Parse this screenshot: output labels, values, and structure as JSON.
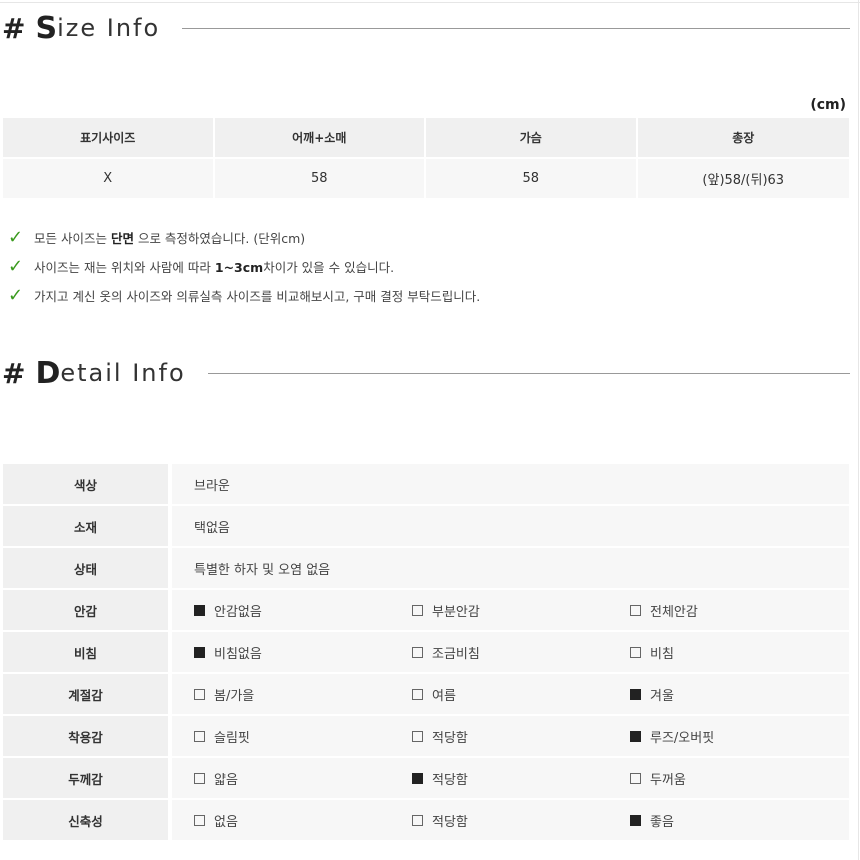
{
  "size_info": {
    "heading_hash": "#",
    "heading_initial": "S",
    "heading_rest": "ize Info",
    "unit": "(cm)",
    "headers": [
      "표기사이즈",
      "어깨+소매",
      "가슴",
      "총장"
    ],
    "rows": [
      [
        "X",
        "58",
        "58",
        "(앞)58/(뒤)63"
      ]
    ],
    "notes": [
      {
        "before": "모든 사이즈는 ",
        "bold": "단면",
        "after": " 으로 측정하였습니다. (단위cm)"
      },
      {
        "before": "사이즈는 재는 위치와 사람에 따라 ",
        "bold": "1~3cm",
        "after": "차이가 있을 수 있습니다."
      },
      {
        "before": "가지고 계신 옷의 사이즈와 의류실측 사이즈를 비교해보시고, 구매 결정 부탁드립니다.",
        "bold": "",
        "after": ""
      }
    ],
    "check_icon": "check-mark-icon",
    "check_color": "#3a9a1e"
  },
  "detail_info": {
    "heading_hash": "#",
    "heading_initial": "D",
    "heading_rest": "etail Info",
    "text_rows": [
      {
        "label": "색상",
        "value": "브라운"
      },
      {
        "label": "소재",
        "value": "택없음"
      },
      {
        "label": "상태",
        "value": "특별한 하자 및 오염 없음"
      }
    ],
    "option_rows": [
      {
        "label": "안감",
        "options": [
          {
            "text": "안감없음",
            "checked": true
          },
          {
            "text": "부분안감",
            "checked": false
          },
          {
            "text": "전체안감",
            "checked": false
          }
        ]
      },
      {
        "label": "비침",
        "options": [
          {
            "text": "비침없음",
            "checked": true
          },
          {
            "text": "조금비침",
            "checked": false
          },
          {
            "text": "비침",
            "checked": false
          }
        ]
      },
      {
        "label": "계절감",
        "options": [
          {
            "text": "봄/가을",
            "checked": false
          },
          {
            "text": "여름",
            "checked": false
          },
          {
            "text": "겨울",
            "checked": true
          }
        ]
      },
      {
        "label": "착용감",
        "options": [
          {
            "text": "슬림핏",
            "checked": false
          },
          {
            "text": "적당함",
            "checked": false
          },
          {
            "text": "루즈/오버핏",
            "checked": true
          }
        ]
      },
      {
        "label": "두께감",
        "options": [
          {
            "text": "얇음",
            "checked": false
          },
          {
            "text": "적당함",
            "checked": true
          },
          {
            "text": "두꺼움",
            "checked": false
          }
        ]
      },
      {
        "label": "신축성",
        "options": [
          {
            "text": "없음",
            "checked": false
          },
          {
            "text": "적당함",
            "checked": false
          },
          {
            "text": "좋음",
            "checked": true
          }
        ]
      }
    ]
  }
}
